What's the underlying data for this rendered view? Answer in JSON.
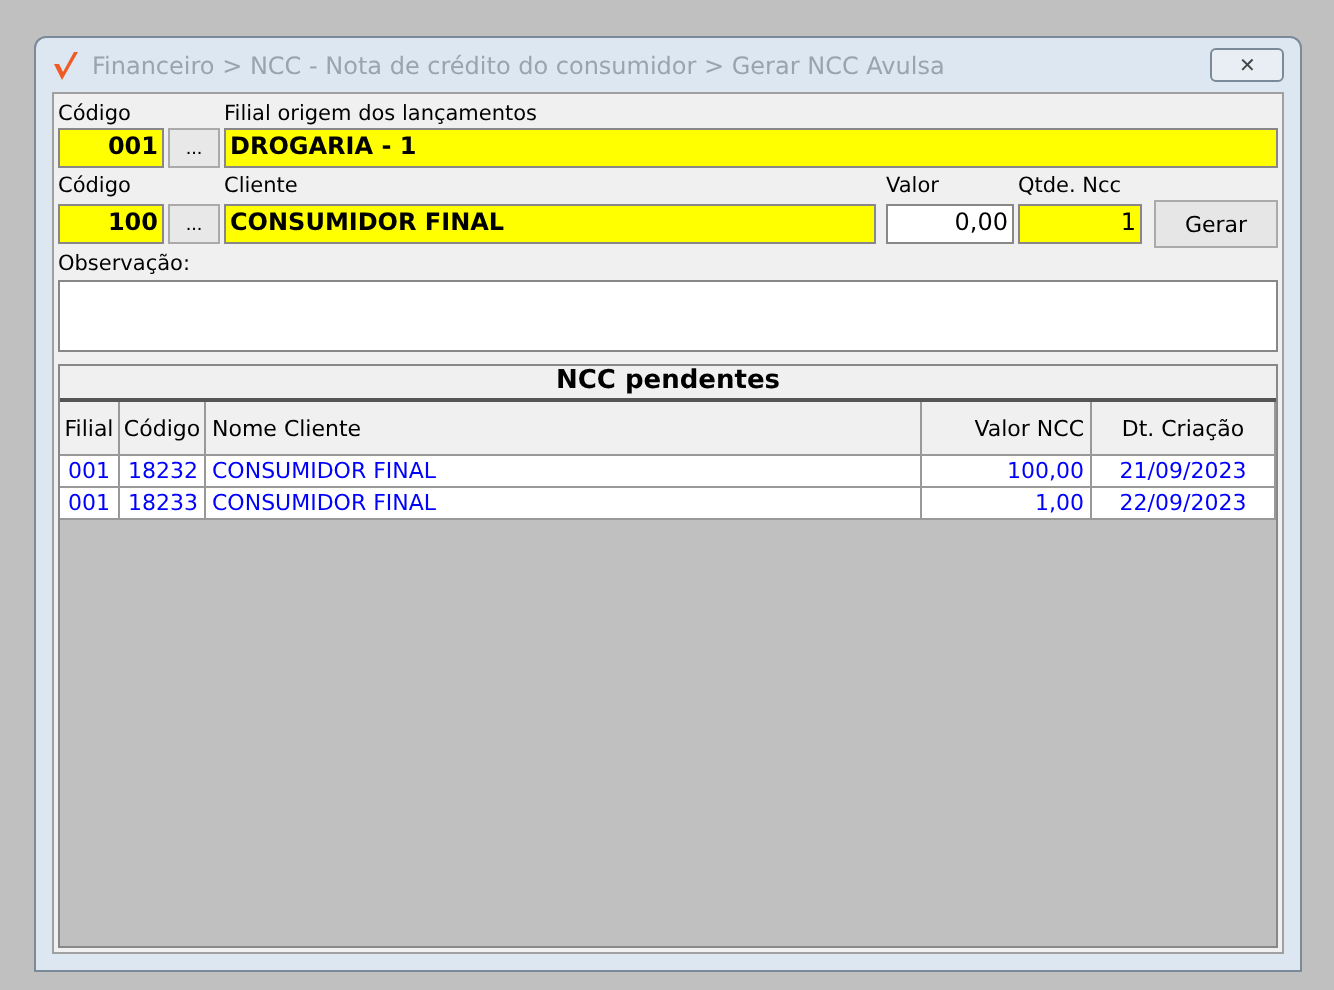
{
  "window": {
    "title": "Financeiro > NCC - Nota de crédito do consumidor > Gerar NCC Avulsa",
    "close": "✕"
  },
  "filial": {
    "code_label": "Código",
    "code": "001",
    "lookup": "...",
    "name_label": "Filial origem dos lançamentos",
    "name": "DROGARIA - 1"
  },
  "cliente": {
    "code_label": "Código",
    "code": "100",
    "lookup": "...",
    "name_label": "Cliente",
    "name": "CONSUMIDOR FINAL",
    "valor_label": "Valor",
    "valor": "0,00",
    "qtde_label": "Qtde. Ncc",
    "qtde": "1",
    "button": "Gerar"
  },
  "observacao": {
    "label": "Observação:"
  },
  "table": {
    "title": "NCC pendentes",
    "columns": [
      "Filial",
      "Código",
      "Nome Cliente",
      "Valor NCC",
      "Dt. Criação"
    ],
    "rows": [
      [
        "001",
        "18232",
        "CONSUMIDOR FINAL",
        "100,00",
        "21/09/2023"
      ],
      [
        "001",
        "18233",
        "CONSUMIDOR FINAL",
        "1,00",
        "22/09/2023"
      ]
    ]
  }
}
